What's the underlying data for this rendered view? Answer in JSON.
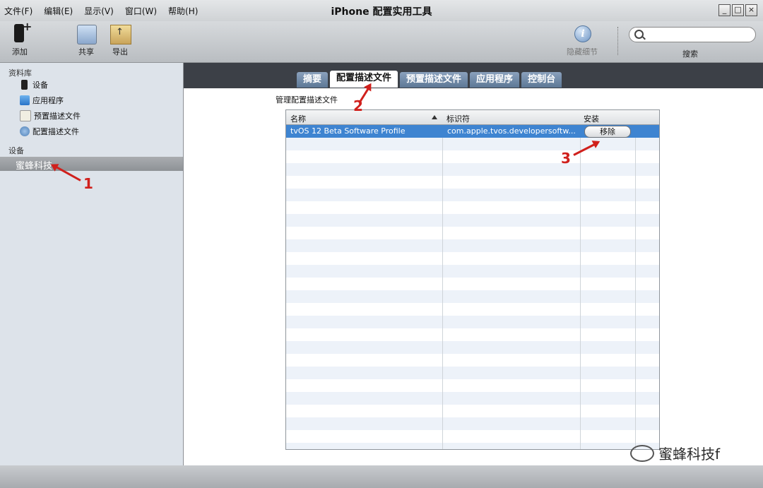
{
  "menu": [
    "文件(F)",
    "编辑(E)",
    "显示(V)",
    "窗口(W)",
    "帮助(H)"
  ],
  "window": {
    "title": "iPhone 配置实用工具",
    "controls": [
      "_",
      "□",
      "×"
    ]
  },
  "toolbar": {
    "add": "添加",
    "share": "共享",
    "export": "导出",
    "hide_details": "隐藏细节",
    "search_label": "搜索",
    "search_placeholder": ""
  },
  "sidebar": {
    "library_header": "资料库",
    "library_items": [
      {
        "label": "设备",
        "icon": "device-icon"
      },
      {
        "label": "应用程序",
        "icon": "app-store-icon"
      },
      {
        "label": "预置描述文件",
        "icon": "provisioning-profile-icon"
      },
      {
        "label": "配置描述文件",
        "icon": "configuration-profile-icon"
      }
    ],
    "devices_header": "设备",
    "selected_device": "蜜蜂科技"
  },
  "tabs": [
    {
      "label": "摘要",
      "active": false
    },
    {
      "label": "配置描述文件",
      "active": true
    },
    {
      "label": "预置描述文件",
      "active": false
    },
    {
      "label": "应用程序",
      "active": false
    },
    {
      "label": "控制台",
      "active": false
    }
  ],
  "content": {
    "section_label": "管理配置描述文件",
    "table": {
      "columns": [
        "名称",
        "标识符",
        "安装"
      ],
      "rows": [
        {
          "name": "tvOS 12 Beta Software Profile",
          "identifier": "com.apple.tvos.developersoftw...",
          "action": "移除",
          "selected": true
        }
      ]
    }
  },
  "annotations": [
    "1",
    "2",
    "3"
  ],
  "watermark": "蜜蜂科技f",
  "colors": {
    "annotation": "#d0201c",
    "selection": "#3e84d1",
    "tab": "#6c86a5"
  }
}
